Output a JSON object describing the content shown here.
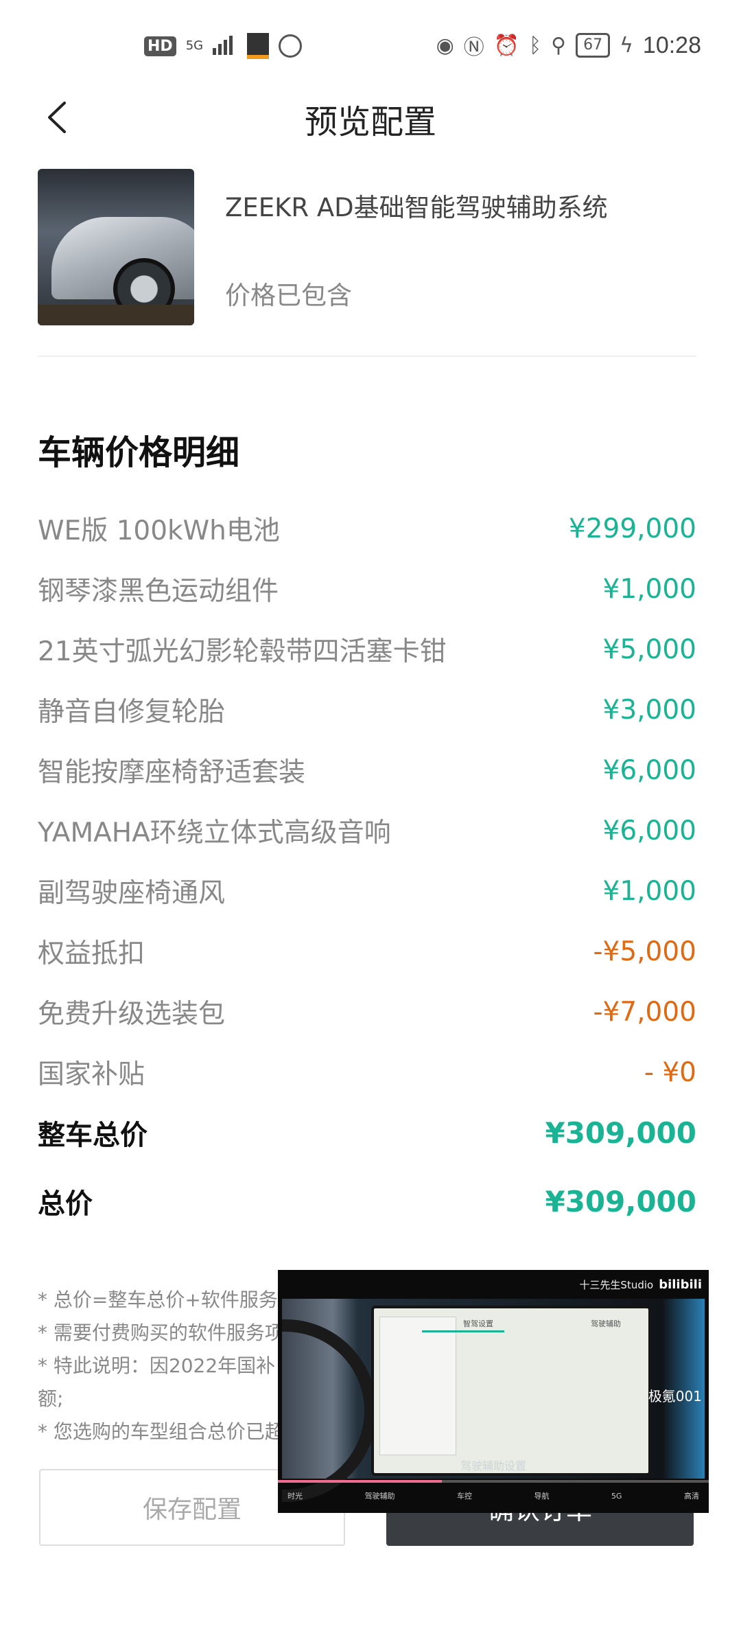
{
  "status_bar": {
    "hd": "HD",
    "network": "5G",
    "battery": "67",
    "time": "10:28",
    "icons": [
      "eye-icon",
      "nfc-icon",
      "alarm-icon",
      "bluetooth-icon",
      "location-icon",
      "charging-icon"
    ]
  },
  "header": {
    "title": "预览配置",
    "back_icon": "chevron-left-icon"
  },
  "product": {
    "name": "ZEEKR AD基础智能驾驶辅助系统",
    "price_note": "价格已包含"
  },
  "price_detail": {
    "title": "车辆价格明细",
    "items": [
      {
        "label": "WE版 100kWh电池",
        "value": "¥299,000",
        "color": "#1ab394"
      },
      {
        "label": "钢琴漆黑色运动组件",
        "value": "¥1,000",
        "color": "#1ab394"
      },
      {
        "label": "21英寸弧光幻影轮毂带四活塞卡钳",
        "value": "¥5,000",
        "color": "#1ab394"
      },
      {
        "label": "静音自修复轮胎",
        "value": "¥3,000",
        "color": "#1ab394"
      },
      {
        "label": "智能按摩座椅舒适套装",
        "value": "¥6,000",
        "color": "#1ab394"
      },
      {
        "label": "YAMAHA环绕立体式高级音响",
        "value": "¥6,000",
        "color": "#1ab394"
      },
      {
        "label": "副驾驶座椅通风",
        "value": "¥1,000",
        "color": "#1ab394"
      },
      {
        "label": "权益抵扣",
        "value": "-¥5,000",
        "color": "#e06a14"
      },
      {
        "label": "免费升级选装包",
        "value": "-¥7,000",
        "color": "#e06a14"
      },
      {
        "label": "国家补贴",
        "value": "- ¥0",
        "color": "#e06a14"
      }
    ],
    "vehicle_total_label": "整车总价",
    "vehicle_total_value": "¥309,000",
    "total_label": "总价",
    "total_value": "¥309,000"
  },
  "notes": [
    "* 总价=整车总价+软件服务总",
    "* 需要付费购买的软件服务项",
    "* 特此说明：因2022年国补",
    "额;",
    "* 您选购的车型组合总价已超"
  ],
  "buttons": {
    "save": "保存配置",
    "confirm": "确认订单"
  },
  "video_overlay": {
    "uploader": "十三先生Studio",
    "platform": "bilibili",
    "watermark": "极氪001",
    "subtitle": "驾驶辅助设置",
    "screen_tab1": "智驾设置",
    "screen_tab2": "驾驶辅助",
    "progress": 0.38,
    "controls": [
      "时光",
      "驾驶辅助",
      "车控",
      "导航",
      "5G",
      "高清"
    ]
  }
}
